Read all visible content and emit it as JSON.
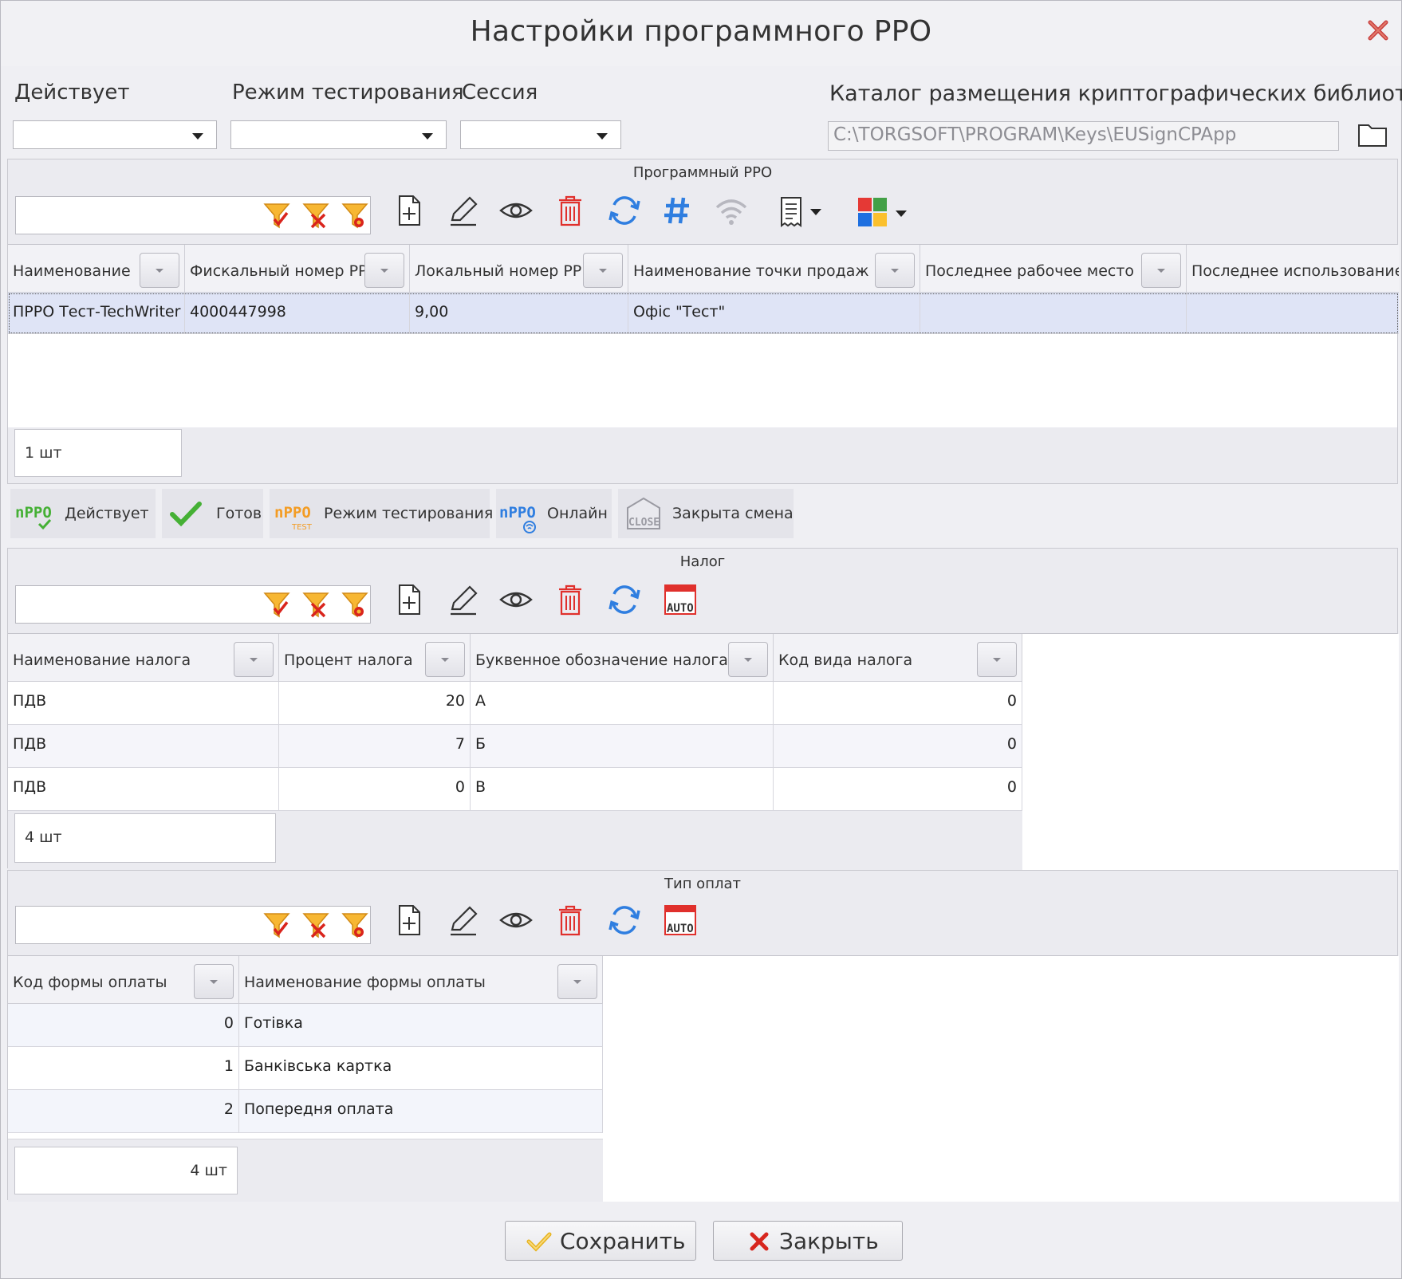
{
  "window": {
    "title": "Настройки программного РРО"
  },
  "filters": {
    "active_label": "Действует",
    "test_mode_label": "Режим тестирования",
    "session_label": "Сессия",
    "catalog_label": "Каталог размещения криптографических библиотек",
    "catalog_path": "C:\\TORGSOFT\\PROGRAM\\Keys\\EUSignCPApp"
  },
  "prro": {
    "title": "Программный РРО",
    "columns": [
      "Наименование",
      "Фискальный номер РР",
      "Локальный номер РР",
      "Наименование точки продаж",
      "Последнее рабочее место",
      "Последнее использование"
    ],
    "rows": [
      [
        "ПРРО Тест-TechWriter",
        "4000447998",
        "9,00",
        "Офіс \"Тест\"",
        "",
        ""
      ]
    ],
    "count": "1 шт"
  },
  "status_legend": [
    {
      "label": "Действует",
      "icon": "prro-active-icon"
    },
    {
      "label": "Готов",
      "icon": "checkmark-icon"
    },
    {
      "label": "Режим тестирования",
      "icon": "prro-test-icon"
    },
    {
      "label": "Онлайн",
      "icon": "prro-online-icon"
    },
    {
      "label": "Закрыта смена",
      "icon": "close-shift-icon"
    }
  ],
  "tax": {
    "title": "Налог",
    "columns": [
      "Наименование налога",
      "Процент налога",
      "Буквенное обозначение налога",
      "Код вида налога"
    ],
    "rows": [
      [
        "ПДВ",
        "20",
        "А",
        "0"
      ],
      [
        "ПДВ",
        "7",
        "Б",
        "0"
      ],
      [
        "ПДВ",
        "0",
        "В",
        "0"
      ]
    ],
    "count": "4 шт"
  },
  "payment": {
    "title": "Тип оплат",
    "columns": [
      "Код формы оплаты",
      "Наименование формы оплаты"
    ],
    "rows": [
      [
        "0",
        "Готівка"
      ],
      [
        "1",
        "Банківська картка"
      ],
      [
        "2",
        "Попередня оплата"
      ]
    ],
    "count": "4 шт"
  },
  "buttons": {
    "save": "Сохранить",
    "close": "Закрыть"
  },
  "colors": {
    "selection": "#dfe4f6",
    "accent_blue": "#2f7ee0",
    "delete_red": "#e0302c",
    "filter_orange": "#f5a623",
    "ok_green": "#45b035"
  }
}
